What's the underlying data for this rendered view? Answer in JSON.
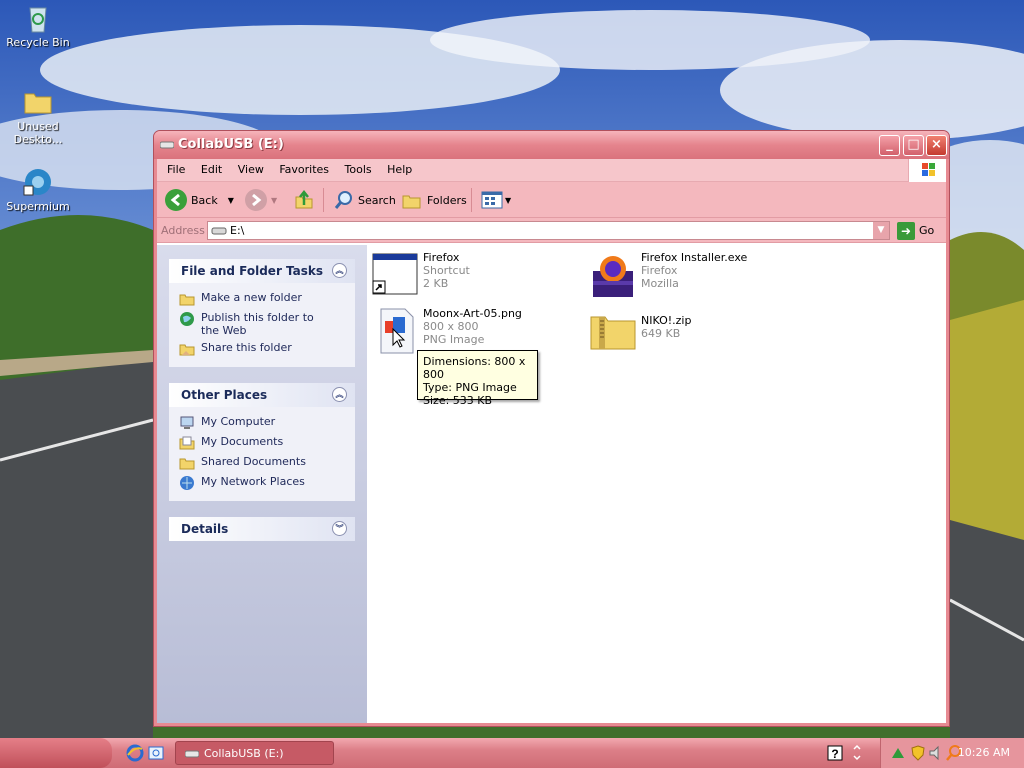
{
  "desktop": {
    "icons": [
      {
        "label": "Recycle Bin",
        "icon": "recycle-bin-icon"
      },
      {
        "label": "Unused Deskto...",
        "icon": "folder-icon"
      },
      {
        "label": "Supermium",
        "icon": "supermium-icon"
      }
    ]
  },
  "window": {
    "title": "CollabUSB (E:)",
    "menu": [
      "File",
      "Edit",
      "View",
      "Favorites",
      "Tools",
      "Help"
    ],
    "toolbar": {
      "back": "Back",
      "search": "Search",
      "folders": "Folders"
    },
    "address": {
      "label": "Address",
      "value": "E:\\",
      "go": "Go"
    },
    "tasks_panel": {
      "title": "File and Folder Tasks",
      "items": [
        "Make a new folder",
        "Publish this folder to the Web",
        "Share this folder"
      ]
    },
    "places_panel": {
      "title": "Other Places",
      "items": [
        "My Computer",
        "My Documents",
        "Shared Documents",
        "My Network Places"
      ]
    },
    "details_panel": {
      "title": "Details"
    },
    "files": [
      {
        "name": "Firefox",
        "line2": "Shortcut",
        "line3": "2 KB"
      },
      {
        "name": "Firefox Installer.exe",
        "line2": "Firefox",
        "line3": "Mozilla"
      },
      {
        "name": "Moonx-Art-05.png",
        "line2": "800 x 800",
        "line3": "PNG Image"
      },
      {
        "name": "NIKO!.zip",
        "line2": "649 KB",
        "line3": ""
      }
    ],
    "tooltip": [
      "Dimensions: 800 x 800",
      "Type: PNG Image",
      "Size: 533 KB"
    ]
  },
  "taskbar": {
    "task_button": "CollabUSB (E:)",
    "clock": "10:26 AM"
  },
  "colors": {
    "theme_accent": "#e5848d",
    "title_close": "#c43a30",
    "tooltip_bg": "#ffffe1"
  }
}
